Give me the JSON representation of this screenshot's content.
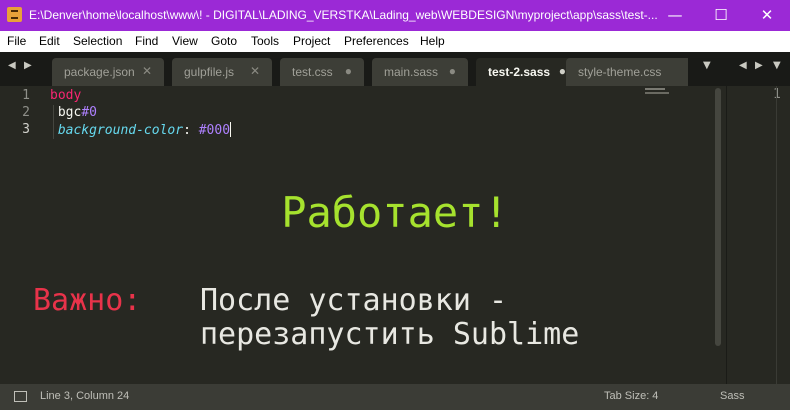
{
  "window": {
    "title": "E:\\Denver\\home\\localhost\\www\\! - DIGITAL\\LADING_VERSTKA\\Lading_web\\WEBDESIGN\\myproject\\app\\sass\\test-...",
    "minimize_glyph": "—",
    "maximize_glyph": "☐",
    "close_glyph": "✕"
  },
  "menu": [
    "File",
    "Edit",
    "Selection",
    "Find",
    "View",
    "Goto",
    "Tools",
    "Project",
    "Preferences",
    "Help"
  ],
  "tabs": [
    {
      "label": "package.json",
      "close": "✕"
    },
    {
      "label": "gulpfile.js",
      "close": "✕"
    },
    {
      "label": "test.css",
      "close": "●"
    },
    {
      "label": "main.sass",
      "close": "●"
    },
    {
      "label": "test-2.sass",
      "close": "●"
    },
    {
      "label": "style-theme.css",
      "close": "✕"
    }
  ],
  "nav": {
    "left": "◀",
    "right": "▶",
    "overflow": "▼"
  },
  "editor": {
    "line_numbers": [
      "1",
      "2",
      "3"
    ],
    "line1": {
      "text": "body"
    },
    "line2": {
      "prop": "bgc",
      "value": "#0"
    },
    "line3": {
      "prop": "background-color",
      "colon": ":",
      "value": "#000"
    }
  },
  "right_pane": {
    "line_number": "1"
  },
  "overlay": {
    "works": "Работает!",
    "important": "Важно:",
    "line1": "После установки -",
    "line2": "перезапустить Sublime"
  },
  "status": {
    "position": "Line 3, Column 24",
    "tab_size": "Tab Size: 4",
    "syntax": "Sass"
  },
  "colors": {
    "titlebar": "#9b29d6",
    "editor_bg": "#272822",
    "works_text": "#a6e22e",
    "important_text": "#e8334a"
  }
}
